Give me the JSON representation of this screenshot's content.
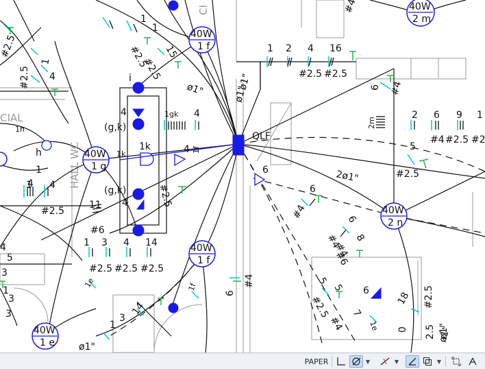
{
  "statusbar": {
    "paper_label": "PAPER",
    "buttons": [
      "model-grid",
      "snap-mode",
      "ortho",
      "polar",
      "lineweight",
      "annotation-scale"
    ]
  },
  "labels": {
    "panel": "QLF",
    "hall": "HALL WC",
    "room_partial": "CIAL",
    "corner_partial": "CI",
    "lamp_text": "40W",
    "lamps": [
      "2 m",
      "1 f",
      "1 g",
      "2 n",
      "1 f",
      "1 e"
    ],
    "circuits_top": [
      "1",
      "2",
      "4",
      "16"
    ],
    "circuits_top_wire": [
      "#2.5",
      "#2.5"
    ],
    "circuits_right": [
      "2",
      "6",
      "9",
      "1"
    ],
    "circuits_right_wire": [
      "#4",
      "#2.5",
      "#2.5"
    ],
    "circuits_bottom": [
      "1",
      "3",
      "4",
      "14"
    ],
    "circuits_bottom_wire": [
      "#2.5",
      "#2.5",
      "#2.5"
    ],
    "conduit_1": "ø1\"",
    "conduit_2": "2ø1\"",
    "conduit_3": "ø1\"",
    "conduit_4": "ø1\"",
    "switch_gk_1": "(g,k)",
    "switch_gk_2": "(g,k)",
    "switch_labels": [
      "4",
      "4",
      "1gk",
      "4",
      "1k",
      "1f",
      "4",
      "1k",
      "i",
      "h"
    ],
    "misc": [
      "#4",
      "6",
      "#4",
      "6",
      "#4",
      "5",
      "#2.5",
      "6",
      "#4",
      "6",
      "#4",
      "#6",
      "8",
      "5",
      "#2.5",
      "5",
      "#4",
      "7",
      "1e",
      "6",
      "18",
      "#2.5",
      "0",
      "2.5",
      "ø1\"",
      "11",
      "#6",
      "#2.5",
      "6",
      "#4",
      "1e",
      "14",
      "1",
      "3",
      "1f",
      "#2.5",
      "1",
      "4",
      "1",
      "4",
      "#2.5",
      "1",
      "4",
      "#2.5",
      "1h",
      "1",
      "#2.5",
      "15",
      "#2.5",
      "1",
      "4",
      "3",
      "1",
      "3",
      "5",
      "3",
      "2m",
      "ø1\"",
      "ø1\""
    ]
  },
  "colors": {
    "line": "#111111",
    "wall": "#9a9a9a",
    "marker": "#00c8c8",
    "tick": "#22b24a",
    "symbol": "#1a1ae6"
  }
}
